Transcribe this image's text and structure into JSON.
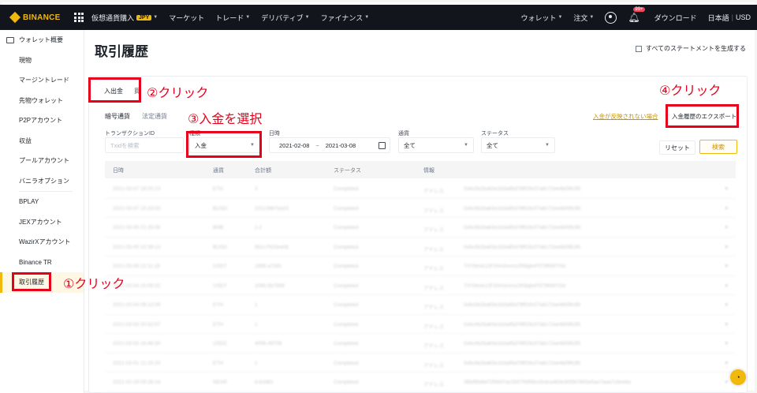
{
  "topnav": {
    "logo_text": "BINANCE",
    "items": [
      "仮想通貨購入",
      "マーケット",
      "トレード",
      "デリバティブ",
      "ファイナンス"
    ],
    "jpy_badge": "JPY",
    "wallet": "ウォレット",
    "orders": "注文",
    "notif_count": "99+",
    "download": "ダウンロード",
    "language": "日本語",
    "currency": "USD",
    "separator": "|"
  },
  "sidebar": {
    "header": "ウォレット概要",
    "items": [
      "現物",
      "マージントレード",
      "先物ウォレット",
      "P2Pアカウント",
      "収益",
      "プールアカウント",
      "バニラオプション",
      "BPLAY",
      "JEXアカウント",
      "WazirXアカウント",
      "Binance TR",
      "取引履歴"
    ]
  },
  "page": {
    "title": "取引履歴",
    "statement_link": "すべてのステートメントを生成する"
  },
  "tabs": {
    "deposit_withdraw": "入出金",
    "other_fragment": "買"
  },
  "subtabs": {
    "crypto": "暗号通貨",
    "fiat": "法定通貨"
  },
  "filters": {
    "txid_label": "トランザクションID",
    "txid_placeholder": "Txidを検索",
    "type_label": "種類",
    "type_value": "入金",
    "date_label": "日時",
    "date_from": "2021-02-08",
    "date_sep": "~",
    "date_to": "2021-03-08",
    "currency_label": "通貨",
    "currency_value": "全て",
    "status_label": "ステータス",
    "status_value": "全て",
    "reset": "リセット",
    "search": "検索",
    "not_reflected_link": "入金が反映されない場合",
    "export_button": "入金履歴のエクスポート"
  },
  "table": {
    "headers": [
      "日時",
      "通貨",
      "合計額",
      "ステータス",
      "情報"
    ],
    "rows": [
      [
        "2021-03-07 18:00:13",
        "ETH",
        "3",
        "Completed",
        "アドレス",
        "0x6c0b2ba63e1b3a85d78ff19c07a8c72ee4b09fc95"
      ],
      [
        "2021-03-07 15:23:03",
        "BUSD",
        "10113987ea23",
        "Completed",
        "アドレス",
        "0x6c0b2ba63e1b3a85d78ff19c07a8c72ee4b09fc95"
      ],
      [
        "2021-03-05 21:25:06",
        "BNB",
        "1.2",
        "Completed",
        "アドレス",
        "0x6c0b2ba63e1b3a85d78ff19c07a8c72ee4b09fc95"
      ],
      [
        "2021-03-05 10:39:13",
        "BUSD",
        "5b1c7910ea08",
        "Completed",
        "アドレス",
        "0x6c0b2ba63e1b3a85d78ff19c07a8c72ee4b09fc95"
      ],
      [
        "2021-03-06 22:11:18",
        "USDT",
        "1995.a7281",
        "Completed",
        "アドレス",
        "TXYbhvk12F2Hn3vvmz2R8qbxF5T9RWTGb"
      ],
      [
        "2021-03-04 10:09:02",
        "USDT",
        "2095.5b7956",
        "Completed",
        "アドレス",
        "TXYbhvk12F2Hn3vvmz2R8qbxF5T9RWTGb"
      ],
      [
        "2021-03-04 09:12:09",
        "ETH",
        "1",
        "Completed",
        "アドレス",
        "0x6c0b2ba63e1b3a85d78ff19c07a8c72ee4b09fc95"
      ],
      [
        "2021-03-03 20:52:07",
        "ETH",
        "1",
        "Completed",
        "アドレス",
        "0x6c0b2ba63e1b3a85d78ff19c07a8c72ee4b09fc95"
      ],
      [
        "2021-03-03 16:46:30",
        "USDC",
        "4056.49709",
        "Completed",
        "アドレス",
        "0x6c0b2ba63e1b3a85d78ff19c07a8c72ee4b09fc95"
      ],
      [
        "2021-03-01 21:15:20",
        "ETH",
        "1",
        "Completed",
        "アドレス",
        "0x6c0b2ba63e1b3a85d78ff19c07a8c72ee4b09fc95"
      ],
      [
        "2021-02-28 09:28:16",
        "NEAR",
        "6.61882",
        "Completed",
        "アドレス",
        "3Bbf9fa6d72f5b07ac2b570bf98ccfcdca483e3f35b7865e5ae7aaa7c5ee6a"
      ]
    ]
  },
  "annotations": {
    "a1": "①クリック",
    "a2": "②クリック",
    "a3": "③入金を選択",
    "a4": "④クリック"
  },
  "colors": {
    "brand": "#f0b90b",
    "nav_bg": "#12161c",
    "highlight_red": "#e6001a"
  }
}
